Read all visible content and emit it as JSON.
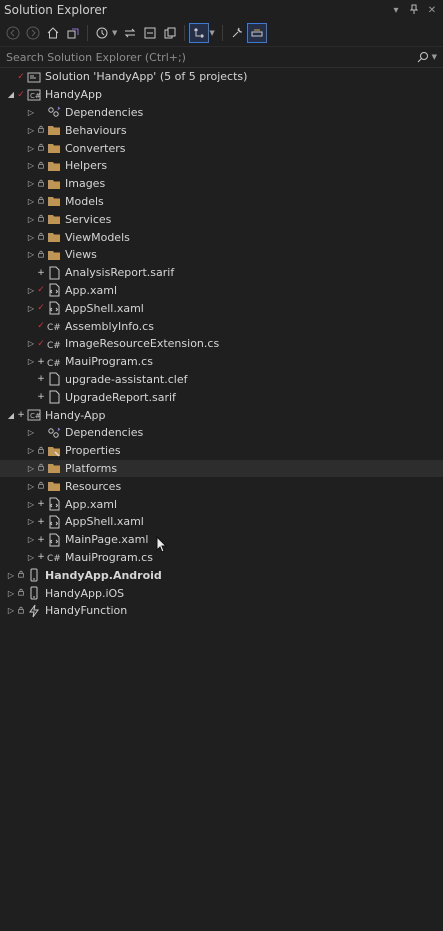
{
  "window": {
    "title": "Solution Explorer"
  },
  "search": {
    "placeholder": "Search Solution Explorer (Ctrl+;)"
  },
  "tree": [
    {
      "label": "Solution 'HandyApp' (5 of 5 projects)",
      "indent": 0,
      "expander": "",
      "state": "check",
      "icon": "solution-icon",
      "name": "solution-root"
    },
    {
      "label": "HandyApp",
      "indent": 0,
      "expander": "open",
      "state": "check",
      "icon": "csharp-project-icon",
      "name": "project-handyapp"
    },
    {
      "label": "Dependencies",
      "indent": 1,
      "expander": "closed",
      "state": "",
      "icon": "dependencies-icon",
      "name": "dependencies"
    },
    {
      "label": "Behaviours",
      "indent": 1,
      "expander": "closed",
      "state": "lock",
      "icon": "folder-icon",
      "name": "folder-behaviours"
    },
    {
      "label": "Converters",
      "indent": 1,
      "expander": "closed",
      "state": "lock",
      "icon": "folder-icon",
      "name": "folder-converters"
    },
    {
      "label": "Helpers",
      "indent": 1,
      "expander": "closed",
      "state": "lock",
      "icon": "folder-icon",
      "name": "folder-helpers"
    },
    {
      "label": "Images",
      "indent": 1,
      "expander": "closed",
      "state": "lock",
      "icon": "folder-icon",
      "name": "folder-images"
    },
    {
      "label": "Models",
      "indent": 1,
      "expander": "closed",
      "state": "lock",
      "icon": "folder-icon",
      "name": "folder-models"
    },
    {
      "label": "Services",
      "indent": 1,
      "expander": "closed",
      "state": "lock",
      "icon": "folder-icon",
      "name": "folder-services"
    },
    {
      "label": "ViewModels",
      "indent": 1,
      "expander": "closed",
      "state": "lock",
      "icon": "folder-icon",
      "name": "folder-viewmodels"
    },
    {
      "label": "Views",
      "indent": 1,
      "expander": "closed",
      "state": "lock",
      "icon": "folder-icon",
      "name": "folder-views"
    },
    {
      "label": "AnalysisReport.sarif",
      "indent": 1,
      "expander": "",
      "state": "plus",
      "icon": "file-icon",
      "name": "file-analysisreport"
    },
    {
      "label": "App.xaml",
      "indent": 1,
      "expander": "closed",
      "state": "check",
      "icon": "xaml-file-icon",
      "name": "file-app-xaml"
    },
    {
      "label": "AppShell.xaml",
      "indent": 1,
      "expander": "closed",
      "state": "check",
      "icon": "xaml-file-icon",
      "name": "file-appshell-xaml"
    },
    {
      "label": "AssemblyInfo.cs",
      "indent": 1,
      "expander": "",
      "state": "check",
      "icon": "csharp-file-icon",
      "name": "file-assemblyinfo"
    },
    {
      "label": "ImageResourceExtension.cs",
      "indent": 1,
      "expander": "closed",
      "state": "check",
      "icon": "csharp-file-icon",
      "name": "file-imageresourceextension"
    },
    {
      "label": "MauiProgram.cs",
      "indent": 1,
      "expander": "closed",
      "state": "plus",
      "icon": "csharp-file-icon",
      "name": "file-mauiprogram"
    },
    {
      "label": "upgrade-assistant.clef",
      "indent": 1,
      "expander": "",
      "state": "plus",
      "icon": "file-icon",
      "name": "file-upgrade-assistant"
    },
    {
      "label": "UpgradeReport.sarif",
      "indent": 1,
      "expander": "",
      "state": "plus",
      "icon": "file-icon",
      "name": "file-upgradereport"
    },
    {
      "label": "Handy-App",
      "indent": 0,
      "expander": "open",
      "state": "plus",
      "icon": "csharp-project-icon",
      "name": "project-handy-app"
    },
    {
      "label": "Dependencies",
      "indent": 1,
      "expander": "closed",
      "state": "",
      "icon": "dependencies-icon",
      "name": "dependencies-2"
    },
    {
      "label": "Properties",
      "indent": 1,
      "expander": "closed",
      "state": "lock",
      "icon": "properties-icon",
      "name": "folder-properties"
    },
    {
      "label": "Platforms",
      "indent": 1,
      "expander": "closed",
      "state": "lock",
      "icon": "folder-icon",
      "name": "folder-platforms",
      "selected": true
    },
    {
      "label": "Resources",
      "indent": 1,
      "expander": "closed",
      "state": "lock",
      "icon": "folder-icon",
      "name": "folder-resources"
    },
    {
      "label": "App.xaml",
      "indent": 1,
      "expander": "closed",
      "state": "plus",
      "icon": "xaml-file-icon",
      "name": "file-app-xaml-2"
    },
    {
      "label": "AppShell.xaml",
      "indent": 1,
      "expander": "closed",
      "state": "plus",
      "icon": "xaml-file-icon",
      "name": "file-appshell-xaml-2"
    },
    {
      "label": "MainPage.xaml",
      "indent": 1,
      "expander": "closed",
      "state": "plus",
      "icon": "xaml-file-icon",
      "name": "file-mainpage-xaml"
    },
    {
      "label": "MauiProgram.cs",
      "indent": 1,
      "expander": "closed",
      "state": "plus",
      "icon": "csharp-file-icon",
      "name": "file-mauiprogram-2"
    },
    {
      "label": "HandyApp.Android",
      "indent": 0,
      "expander": "closed",
      "state": "lock",
      "icon": "android-project-icon",
      "name": "project-android",
      "bold": true
    },
    {
      "label": "HandyApp.iOS",
      "indent": 0,
      "expander": "closed",
      "state": "lock",
      "icon": "ios-project-icon",
      "name": "project-ios"
    },
    {
      "label": "HandyFunction",
      "indent": 0,
      "expander": "closed",
      "state": "lock",
      "icon": "function-project-icon",
      "name": "project-handyfunction"
    }
  ],
  "colors": {
    "folder": "#c09553",
    "accent": "#3b7bd4",
    "check": "#d13438"
  }
}
